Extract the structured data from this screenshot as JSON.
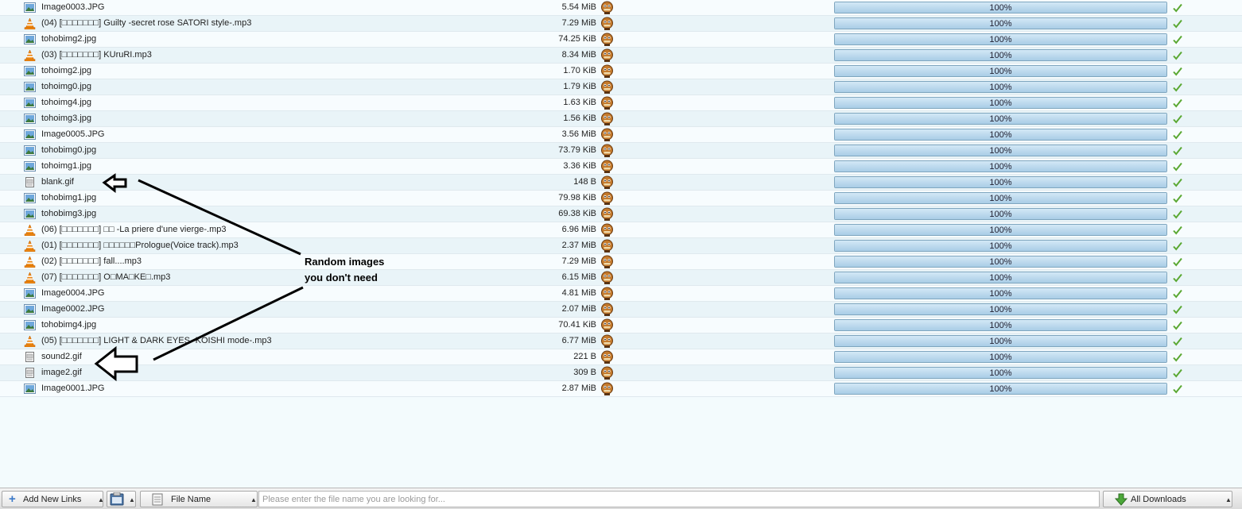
{
  "files": [
    {
      "name": "Image0003.JPG",
      "size": "5.54 MiB",
      "type": "image",
      "progress_pct": 100,
      "progress_label": "100%"
    },
    {
      "name": "(04) [□□□□□□□] Guilty -secret rose SATORI style-.mp3",
      "size": "7.29 MiB",
      "type": "audio",
      "progress_pct": 100,
      "progress_label": "100%"
    },
    {
      "name": "tohobimg2.jpg",
      "size": "74.25 KiB",
      "type": "image",
      "progress_pct": 100,
      "progress_label": "100%"
    },
    {
      "name": "(03) [□□□□□□□] KUruRI.mp3",
      "size": "8.34 MiB",
      "type": "audio",
      "progress_pct": 100,
      "progress_label": "100%"
    },
    {
      "name": "tohoimg2.jpg",
      "size": "1.70 KiB",
      "type": "image",
      "progress_pct": 100,
      "progress_label": "100%"
    },
    {
      "name": "tohoimg0.jpg",
      "size": "1.79 KiB",
      "type": "image",
      "progress_pct": 100,
      "progress_label": "100%"
    },
    {
      "name": "tohoimg4.jpg",
      "size": "1.63 KiB",
      "type": "image",
      "progress_pct": 100,
      "progress_label": "100%"
    },
    {
      "name": "tohoimg3.jpg",
      "size": "1.56 KiB",
      "type": "image",
      "progress_pct": 100,
      "progress_label": "100%"
    },
    {
      "name": "Image0005.JPG",
      "size": "3.56 MiB",
      "type": "image",
      "progress_pct": 100,
      "progress_label": "100%"
    },
    {
      "name": "tohobimg0.jpg",
      "size": "73.79 KiB",
      "type": "image",
      "progress_pct": 100,
      "progress_label": "100%"
    },
    {
      "name": "tohoimg1.jpg",
      "size": "3.36 KiB",
      "type": "image",
      "progress_pct": 100,
      "progress_label": "100%"
    },
    {
      "name": "blank.gif",
      "size": "148 B",
      "type": "gif",
      "progress_pct": 100,
      "progress_label": "100%"
    },
    {
      "name": "tohobimg1.jpg",
      "size": "79.98 KiB",
      "type": "image",
      "progress_pct": 100,
      "progress_label": "100%"
    },
    {
      "name": "tohobimg3.jpg",
      "size": "69.38 KiB",
      "type": "image",
      "progress_pct": 100,
      "progress_label": "100%"
    },
    {
      "name": "(06) [□□□□□□□] □□ -La priere d'une vierge-.mp3",
      "size": "6.96 MiB",
      "type": "audio",
      "progress_pct": 100,
      "progress_label": "100%"
    },
    {
      "name": "(01) [□□□□□□□] □□□□□□Prologue(Voice track).mp3",
      "size": "2.37 MiB",
      "type": "audio",
      "progress_pct": 100,
      "progress_label": "100%"
    },
    {
      "name": "(02) [□□□□□□□] fall....mp3",
      "size": "7.29 MiB",
      "type": "audio",
      "progress_pct": 100,
      "progress_label": "100%"
    },
    {
      "name": "(07) [□□□□□□□] O□MA□KE□.mp3",
      "size": "6.15 MiB",
      "type": "audio",
      "progress_pct": 100,
      "progress_label": "100%"
    },
    {
      "name": "Image0004.JPG",
      "size": "4.81 MiB",
      "type": "image",
      "progress_pct": 100,
      "progress_label": "100%"
    },
    {
      "name": "Image0002.JPG",
      "size": "2.07 MiB",
      "type": "image",
      "progress_pct": 100,
      "progress_label": "100%"
    },
    {
      "name": "tohobimg4.jpg",
      "size": "70.41 KiB",
      "type": "image",
      "progress_pct": 100,
      "progress_label": "100%"
    },
    {
      "name": "(05) [□□□□□□□] LIGHT & DARK EYES -KOISHI mode-.mp3",
      "size": "6.77 MiB",
      "type": "audio",
      "progress_pct": 100,
      "progress_label": "100%"
    },
    {
      "name": "sound2.gif",
      "size": "221 B",
      "type": "gif",
      "progress_pct": 100,
      "progress_label": "100%"
    },
    {
      "name": "image2.gif",
      "size": "309 B",
      "type": "gif",
      "progress_pct": 100,
      "progress_label": "100%"
    },
    {
      "name": "Image0001.JPG",
      "size": "2.87 MiB",
      "type": "image",
      "progress_pct": 100,
      "progress_label": "100%"
    }
  ],
  "annotation": {
    "line1": "Random images",
    "line2": "you don't need"
  },
  "toolbar": {
    "add_links_label": "Add New Links",
    "search_field_label": "File Name",
    "search_placeholder": "Please enter the file name you are looking for...",
    "downloads_filter_label": "All Downloads"
  },
  "icons": {
    "image": "image-file-icon",
    "audio": "vlc-cone-icon",
    "gif": "gif-file-icon",
    "host": "host-mascot-icon",
    "done": "checkmark-icon"
  },
  "colors": {
    "progress_fill": "#a9cde6",
    "check": "#5aa832",
    "row_alt": "#e9f4f8"
  }
}
